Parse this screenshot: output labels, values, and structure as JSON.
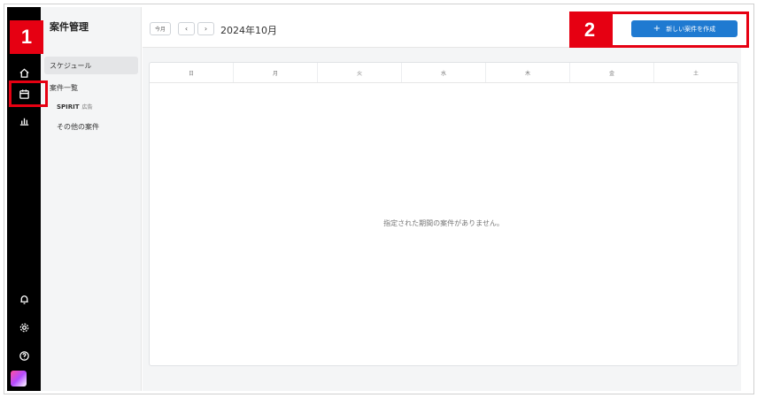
{
  "sidebar": {
    "section_title": "案件管理",
    "items": [
      {
        "label": "スケジュール",
        "active": true
      },
      {
        "label": "案件一覧"
      },
      {
        "label": "SPIRIT",
        "tag": "広告"
      },
      {
        "label": "その他の案件"
      }
    ]
  },
  "rail_icons": [
    "home-icon",
    "calendar-icon",
    "chart-icon",
    "bell-icon",
    "gear-icon",
    "help-icon"
  ],
  "toolbar": {
    "today_label": "今月",
    "prev_label": "‹",
    "next_label": "›",
    "current_month": "2024年10月",
    "create_label": "新しい案件を作成"
  },
  "calendar": {
    "weekdays": [
      "日",
      "月",
      "火",
      "水",
      "木",
      "金",
      "土"
    ],
    "empty_message": "指定された期間の案件がありません。"
  },
  "annotations": [
    {
      "number": "1"
    },
    {
      "number": "2"
    }
  ],
  "colors": {
    "accent": "#1f7ad1",
    "annotation_red": "#e60012",
    "rail_bg": "#000000"
  }
}
